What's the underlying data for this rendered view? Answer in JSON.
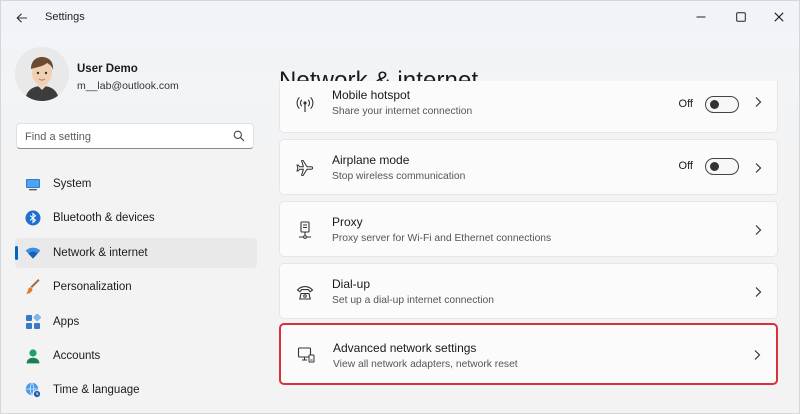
{
  "window": {
    "title": "Settings"
  },
  "user": {
    "name": "User Demo",
    "email": "m__lab@outlook.com"
  },
  "search": {
    "placeholder": "Find a setting"
  },
  "sidebar": {
    "items": [
      {
        "label": "System",
        "icon": "system-icon"
      },
      {
        "label": "Bluetooth & devices",
        "icon": "bluetooth-icon"
      },
      {
        "label": "Network & internet",
        "icon": "wifi-icon",
        "selected": true
      },
      {
        "label": "Personalization",
        "icon": "brush-icon"
      },
      {
        "label": "Apps",
        "icon": "apps-icon"
      },
      {
        "label": "Accounts",
        "icon": "accounts-icon"
      },
      {
        "label": "Time & language",
        "icon": "globe-clock-icon"
      }
    ]
  },
  "main": {
    "title": "Network & internet",
    "cards": [
      {
        "title": "Mobile hotspot",
        "description": "Share your internet connection",
        "state": "Off",
        "icon": "hotspot-icon"
      },
      {
        "title": "Airplane mode",
        "description": "Stop wireless communication",
        "state": "Off",
        "icon": "airplane-icon"
      },
      {
        "title": "Proxy",
        "description": "Proxy server for Wi-Fi and Ethernet connections",
        "icon": "proxy-icon"
      },
      {
        "title": "Dial-up",
        "description": "Set up a dial-up internet connection",
        "icon": "dialup-icon"
      },
      {
        "title": "Advanced network settings",
        "description": "View all network adapters, network reset",
        "icon": "monitor-network-icon"
      }
    ]
  },
  "colors": {
    "accent": "#0067c0",
    "highlight": "#d9303b"
  }
}
